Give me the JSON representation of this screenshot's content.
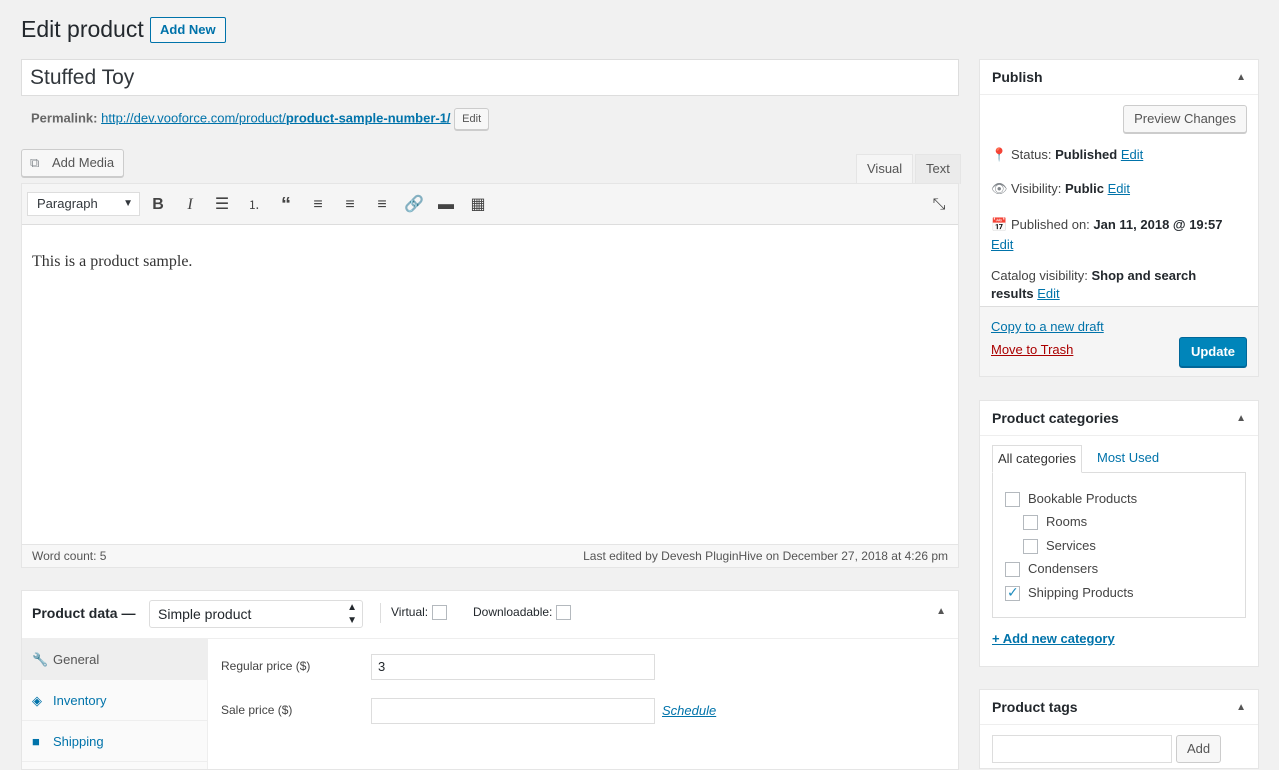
{
  "header": {
    "title": "Edit product",
    "add_new": "Add New"
  },
  "post": {
    "title": "Stuffed Toy",
    "permalink_label": "Permalink:",
    "permalink_base": "http://dev.vooforce.com/product/",
    "permalink_slug": "product-sample-number-1/",
    "permalink_edit": "Edit"
  },
  "editor": {
    "add_media": "Add Media",
    "tab_visual": "Visual",
    "tab_text": "Text",
    "format": "Paragraph",
    "content": "This is a product sample.",
    "word_count": "Word count: 5",
    "last_edited": "Last edited by Devesh PluginHive on December 27, 2018 at 4:26 pm",
    "toolbar_icons": [
      "bold-icon",
      "italic-icon",
      "bullet-list-icon",
      "numbered-list-icon",
      "blockquote-icon",
      "align-left-icon",
      "align-center-icon",
      "align-right-icon",
      "link-icon",
      "read-more-icon",
      "toolbar-toggle-icon",
      "fullscreen-icon"
    ]
  },
  "product_data": {
    "title": "Product data —",
    "type": "Simple product",
    "virtual": "Virtual:",
    "downloadable": "Downloadable:",
    "tabs": [
      {
        "label": "General",
        "icon": "wrench-icon"
      },
      {
        "label": "Inventory",
        "icon": "tag-icon"
      },
      {
        "label": "Shipping",
        "icon": "truck-icon"
      }
    ],
    "regular_price_label": "Regular price ($)",
    "regular_price_value": "3",
    "sale_price_label": "Sale price ($)",
    "sale_price_value": "",
    "schedule": "Schedule"
  },
  "publish": {
    "title": "Publish",
    "preview": "Preview Changes",
    "status_label": "Status:",
    "status_value": "Published",
    "visibility_label": "Visibility:",
    "visibility_value": "Public",
    "published_label": "Published on:",
    "published_value": "Jan 11, 2018 @ 19:57",
    "catalog_label": "Catalog visibility:",
    "catalog_value_1": "Shop and search",
    "catalog_value_2": "results",
    "edit": "Edit",
    "copy_draft": "Copy to a new draft",
    "trash": "Move to Trash",
    "update": "Update"
  },
  "categories": {
    "title": "Product categories",
    "tab_all": "All categories",
    "tab_used": "Most Used",
    "items": [
      {
        "label": "Bookable Products",
        "checked": false
      },
      {
        "label": "Rooms",
        "checked": false
      },
      {
        "label": "Services",
        "checked": false
      },
      {
        "label": "Condensers",
        "checked": false
      },
      {
        "label": "Shipping Products",
        "checked": true
      }
    ],
    "add_new": "+ Add new category"
  },
  "tags": {
    "title": "Product tags",
    "add": "Add",
    "input_value": ""
  }
}
